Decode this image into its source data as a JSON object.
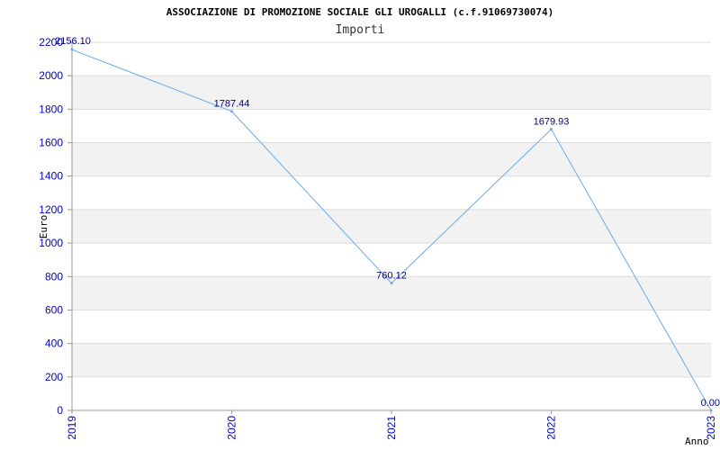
{
  "chart_data": {
    "type": "line",
    "title": "ASSOCIAZIONE DI PROMOZIONE SOCIALE GLI UROGALLI (c.f.91069730074)",
    "subtitle": "Importi",
    "xlabel": "Anno",
    "ylabel": "Euro",
    "categories": [
      "2019",
      "2020",
      "2021",
      "2022",
      "2023"
    ],
    "series": [
      {
        "values": [
          2156.1,
          1787.44,
          760.12,
          1679.93,
          0.0
        ],
        "labels": [
          "2156.10",
          "1787.44",
          "760.12",
          "1679.93",
          "0.00"
        ]
      }
    ],
    "ylim": [
      0,
      2200
    ],
    "yticks": [
      0,
      200,
      400,
      600,
      800,
      1000,
      1200,
      1400,
      1600,
      1800,
      2000,
      2200
    ],
    "grid": true,
    "colors": {
      "line": "#6aa9e6",
      "band": "#f2f2f2",
      "grid": "#dcdcdc",
      "tick_text": "#0000cc",
      "data_label": "#000080",
      "axis": "#999999"
    }
  }
}
